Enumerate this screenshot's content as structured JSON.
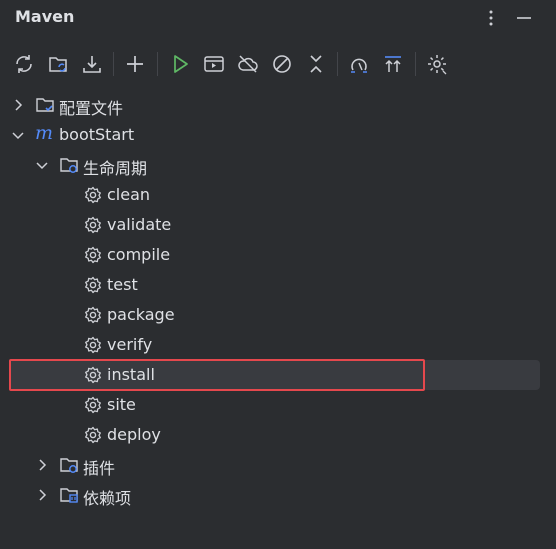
{
  "panel": {
    "title": "Maven"
  },
  "tree": {
    "config": "配置文件",
    "project": "bootStart",
    "lifecycle": "生命周期",
    "goals": [
      "clean",
      "validate",
      "compile",
      "test",
      "package",
      "verify",
      "install",
      "site",
      "deploy"
    ],
    "plugins": "插件",
    "dependencies": "依赖项"
  },
  "selected_goal": "install",
  "colors": {
    "background": "#2b2d30",
    "text": "#dfe1e5",
    "icon": "#ced0d6",
    "run_green": "#5fb865",
    "maven_blue": "#548af7",
    "selection": "#393b40",
    "highlight_red": "#e5484d"
  }
}
